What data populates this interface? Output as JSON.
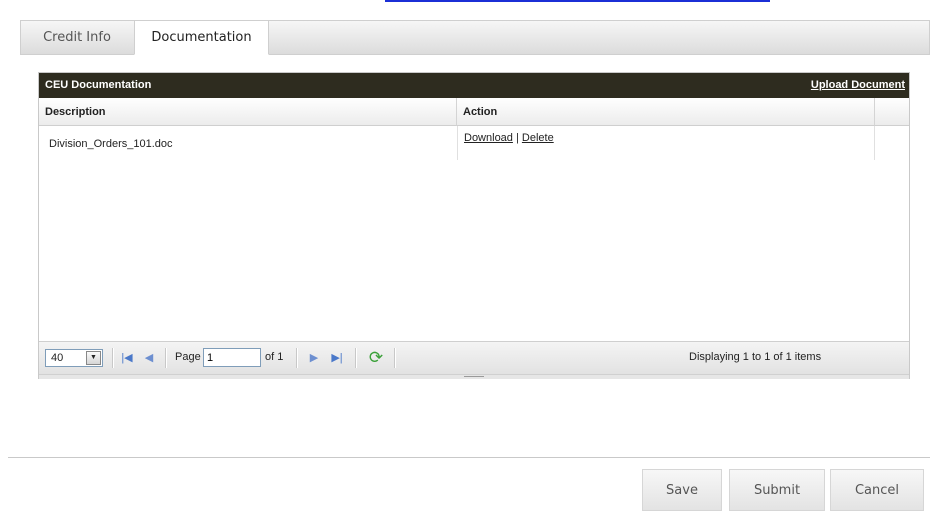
{
  "tabs": [
    {
      "label": "Credit Info",
      "active": false
    },
    {
      "label": "Documentation",
      "active": true
    }
  ],
  "grid": {
    "title": "CEU Documentation",
    "upload_label": "Upload Document",
    "header_color": "#2e2c1f",
    "columns": [
      "Description",
      "Action"
    ],
    "rows": [
      {
        "description": "Division_Orders_101.doc",
        "download_label": "Download",
        "separator": " | ",
        "delete_label": "Delete"
      }
    ],
    "pager": {
      "page_size": "40",
      "page_label": "Page",
      "page_value": "1",
      "of_label": "of 1",
      "display_info": "Displaying 1 to 1 of 1 items",
      "icons": [
        "first-page-icon",
        "prev-page-icon",
        "next-page-icon",
        "last-page-icon",
        "refresh-icon"
      ]
    }
  },
  "footer": {
    "save_label": "Save",
    "submit_label": "Submit",
    "cancel_label": "Cancel"
  }
}
